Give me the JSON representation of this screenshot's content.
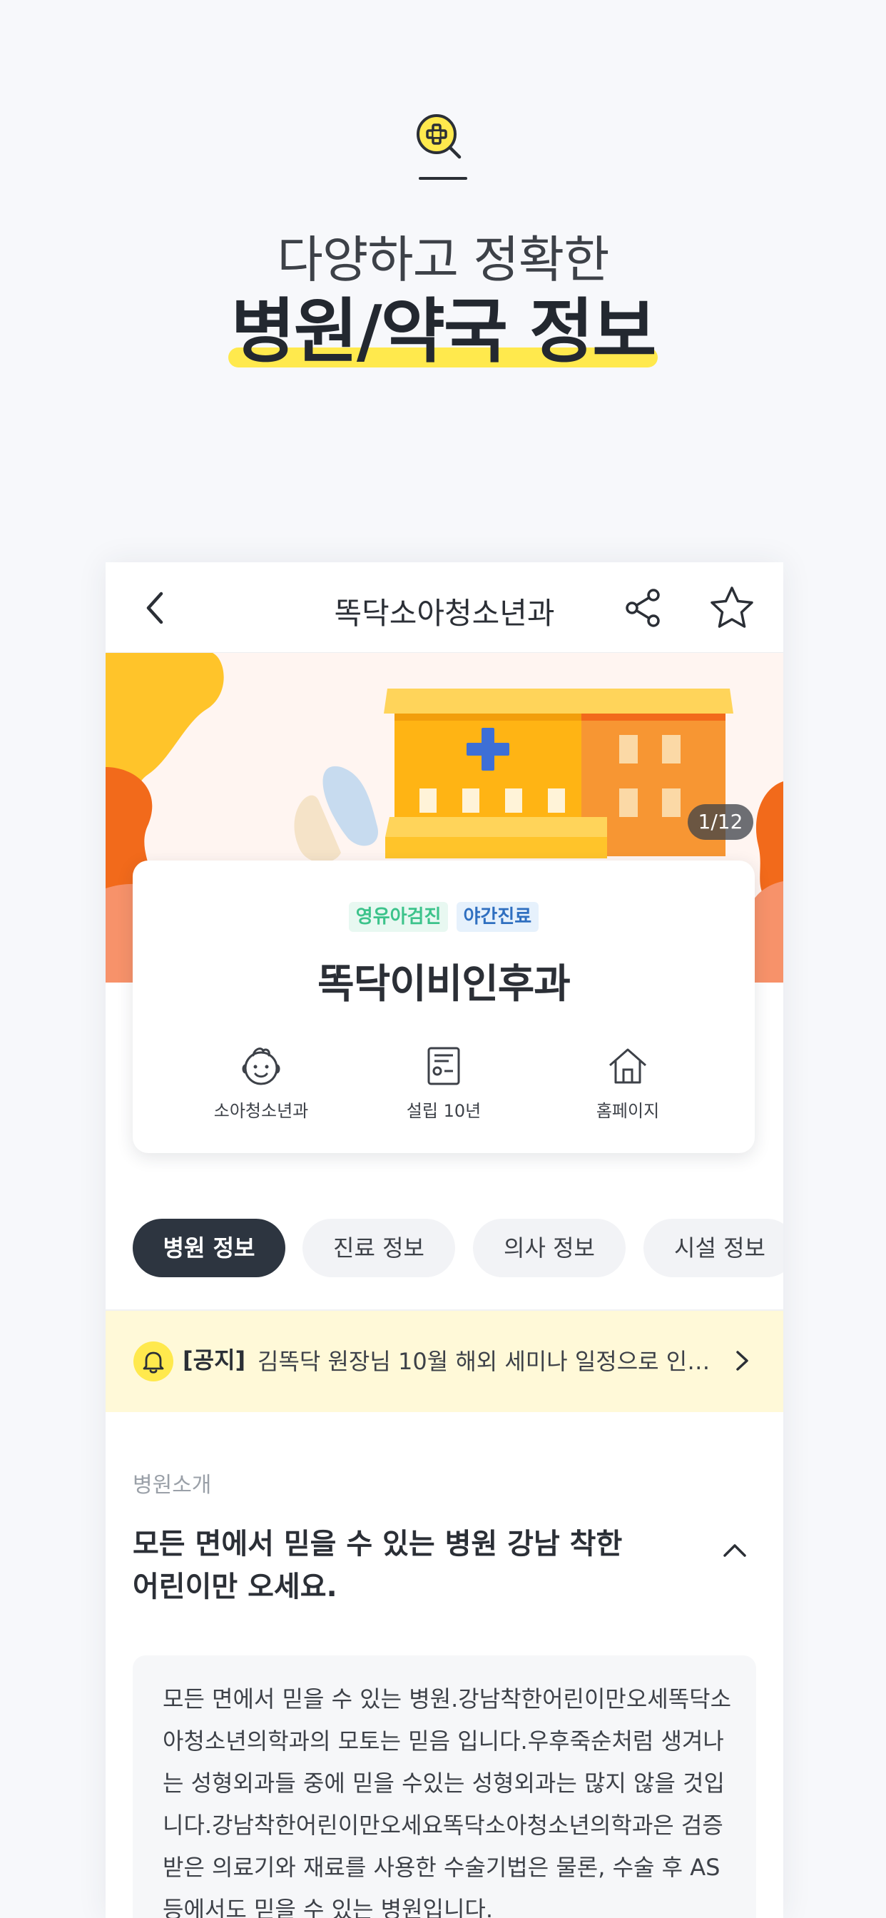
{
  "hero": {
    "icon": "search-plus-icon",
    "subtitle": "다양하고 정확한",
    "title": "병원/약국 정보",
    "accent_color": "#ffe94d"
  },
  "nav": {
    "title": "똑닥소아청소년과",
    "back_icon": "chevron-left-icon",
    "share_icon": "share-icon",
    "favorite_icon": "star-icon"
  },
  "banner": {
    "page_indicator": "1/12"
  },
  "clinic": {
    "tags": [
      {
        "label": "영유아검진",
        "color": "#3cc38b"
      },
      {
        "label": "야간진료",
        "color": "#2f6fc0"
      }
    ],
    "name": "똑닥이비인후과",
    "facts": [
      {
        "icon": "baby-face-icon",
        "label": "소아청소년과"
      },
      {
        "icon": "certificate-icon",
        "label": "설립 10년"
      },
      {
        "icon": "home-icon",
        "label": "홈페이지"
      }
    ]
  },
  "tabs": [
    {
      "label": "병원 정보",
      "active": true
    },
    {
      "label": "진료 정보",
      "active": false
    },
    {
      "label": "의사 정보",
      "active": false
    },
    {
      "label": "시설 정보",
      "active": false
    }
  ],
  "notice": {
    "icon": "bell-icon",
    "tag": "[공지]",
    "text": "김똑닥 원장님 10월 해외 세미나 일정으로 인…"
  },
  "intro": {
    "label": "병원소개",
    "title": "모든 면에서 믿을 수 있는 병원 강남 착한 어린이만 오세요.",
    "description": "모든 면에서 믿을 수 있는 병원.강남착한어린이만오세똑닥소아청소년의학과의 모토는 믿음 입니다.우후죽순처럼 생겨나는 성형외과들 중에 믿을 수있는 성형외과는 많지 않을 것입니다.강남착한어린이만오세요똑닥소아청소년의학과은 검증 받은 의료기와 재료를 사용한 수술기법은 물론, 수술 후 AS등에서도 믿을 수 있는 병원입니다."
  }
}
